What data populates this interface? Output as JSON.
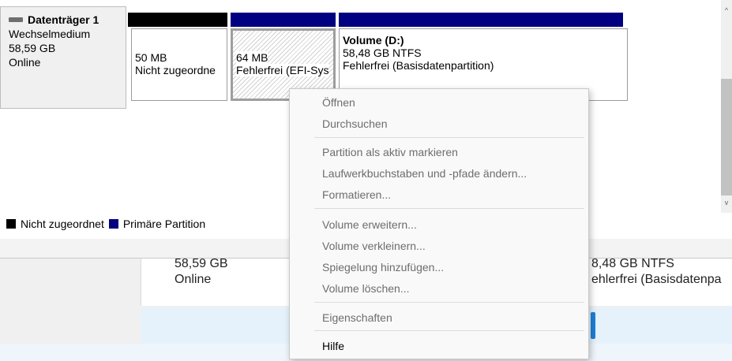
{
  "background_window": {
    "size": "58,59 GB",
    "status": "Online",
    "right_size": "8,48 GB NTFS",
    "right_status": "ehlerfrei (Basisdatenpa"
  },
  "disk": {
    "title": "Datenträger 1",
    "type": "Wechselmedium",
    "size": "58,59 GB",
    "status": "Online"
  },
  "partitions": [
    {
      "size": "50 MB",
      "status": "Nicht zugeordne"
    },
    {
      "size": "64 MB",
      "status": "Fehlerfrei (EFI-Sys"
    },
    {
      "title": "Volume  (D:)",
      "size": "58,48 GB NTFS",
      "status": "Fehlerfrei (Basisdatenpartition)"
    }
  ],
  "legend": {
    "unallocated": "Nicht zugeordnet",
    "primary": "Primäre Partition"
  },
  "scrollbar": {
    "up": "^",
    "down": "v"
  },
  "context_menu": {
    "items": [
      {
        "label": "Öffnen",
        "enabled": false
      },
      {
        "label": "Durchsuchen",
        "enabled": false
      },
      {
        "label": "Partition als aktiv markieren",
        "enabled": false
      },
      {
        "label": "Laufwerkbuchstaben und -pfade ändern...",
        "enabled": false
      },
      {
        "label": "Formatieren...",
        "enabled": false
      },
      {
        "label": "Volume erweitern...",
        "enabled": false
      },
      {
        "label": "Volume verkleinern...",
        "enabled": false
      },
      {
        "label": "Spiegelung hinzufügen...",
        "enabled": false
      },
      {
        "label": "Volume löschen...",
        "enabled": false
      },
      {
        "label": "Eigenschaften",
        "enabled": false
      },
      {
        "label": "Hilfe",
        "enabled": true
      }
    ]
  },
  "colors": {
    "unallocated": "#000000",
    "primary_partition": "#000080"
  }
}
